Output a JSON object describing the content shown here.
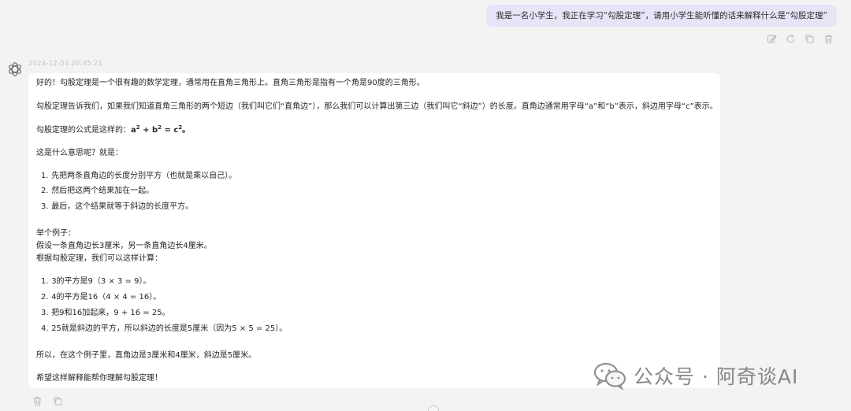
{
  "user_message": {
    "text": "我是一名小学生，我正在学习“勾股定理”，请用小学生能听懂的话来解释什么是“勾股定理”"
  },
  "user_actions": {
    "icons": [
      "edit-icon",
      "refresh-icon",
      "copy-icon",
      "delete-icon"
    ]
  },
  "assistant": {
    "timestamp": "2024-12-04 20:45:21",
    "intro": "好的！勾股定理是一个很有趣的数学定理，通常用在直角三角形上。直角三角形是指有一个角是90度的三角形。",
    "explain": "勾股定理告诉我们，如果我们知道直角三角形的两个短边（我们叫它们“直角边”），那么我们可以计算出第三边（我们叫它“斜边”）的长度。直角边通常用字母“a”和“b”表示，斜边用字母“c”表示。",
    "formula_prefix": "勾股定理的公式是这样的：",
    "formula": {
      "a": "a",
      "plus": " + ",
      "b": "b",
      "eq": " = ",
      "c": "c",
      "exp": "2",
      "end": "。"
    },
    "meaning_intro": "这是什么意思呢？就是：",
    "steps": [
      {
        "num": "1.",
        "text": "先把两条直角边的长度分别平方（也就是乘以自己）。"
      },
      {
        "num": "2.",
        "text": "然后把这两个结果加在一起。"
      },
      {
        "num": "3.",
        "text": "最后，这个结果就等于斜边的长度平方。"
      }
    ],
    "example_title": "举个例子：",
    "example_setup": "假设一条直角边长3厘米，另一条直角边长4厘米。",
    "example_calc_intro": "根据勾股定理，我们可以这样计算：",
    "calc_steps": [
      {
        "num": "1.",
        "text": "3的平方是9（3 × 3 = 9）。"
      },
      {
        "num": "2.",
        "text": "4的平方是16（4 × 4 = 16）。"
      },
      {
        "num": "3.",
        "text": "把9和16加起来，9 + 16 = 25。"
      },
      {
        "num": "4.",
        "text": "25就是斜边的平方，所以斜边的长度是5厘米（因为5 × 5 = 25）。"
      }
    ],
    "conclusion": "所以，在这个例子里，直角边是3厘米和4厘米，斜边是5厘米。",
    "closing": "希望这样解释能帮你理解勾股定理！"
  },
  "bottom_actions": {
    "icons": [
      "delete-icon",
      "copy-icon"
    ]
  },
  "watermark": {
    "text": "公众号 · 阿奇谈AI"
  },
  "colors": {
    "background": "#f3f3f4",
    "user_bubble": "#e7e4f8",
    "card": "#ffffff",
    "text": "#262626",
    "muted": "#c4c4c6"
  }
}
